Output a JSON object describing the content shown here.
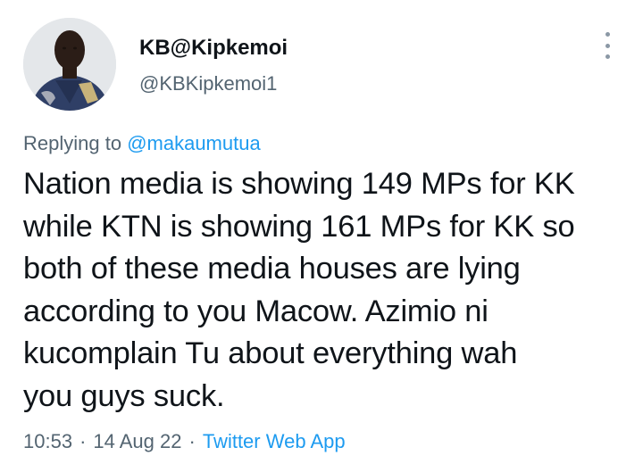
{
  "author": {
    "display_name": "KB@Kipkemoi",
    "handle": "@KBKipkemoi1",
    "avatar": "profile-photo"
  },
  "reply": {
    "prefix": "Replying to ",
    "mention": "@makaumutua"
  },
  "tweet": {
    "lines": [
      "Nation media is showing 149 MPs for KK",
      "while KTN is showing 161 MPs for KK so",
      "both of these media houses are lying",
      "according to you Macow. Azimio ni",
      "kucomplain Tu about everything wah",
      "you guys suck."
    ]
  },
  "meta": {
    "time": "10:53",
    "date": "14 Aug 22",
    "source": "Twitter Web App",
    "separator": "·"
  },
  "colors": {
    "text": "#0f1419",
    "secondary": "#536471",
    "link": "#1d9bf0"
  },
  "icons": {
    "more": "more-options-icon"
  }
}
